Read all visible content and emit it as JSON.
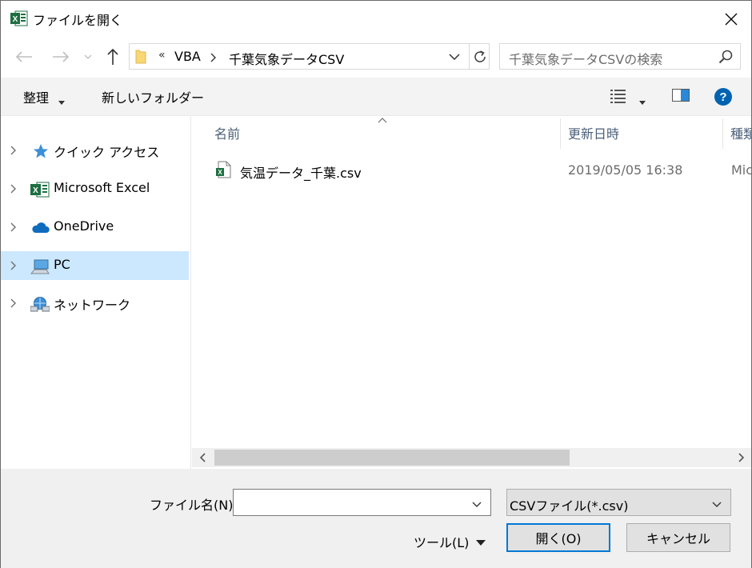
{
  "window": {
    "title": "ファイルを開く"
  },
  "address": {
    "overflow": "«",
    "crumbs": [
      "VBA",
      "千葉気象データCSV"
    ]
  },
  "search": {
    "placeholder": "千葉気象データCSVの検索"
  },
  "toolbar": {
    "organize": "整理",
    "new_folder": "新しいフォルダー"
  },
  "nav": {
    "items": [
      {
        "label": "クイック アクセス",
        "icon": "star-icon"
      },
      {
        "label": "Microsoft Excel",
        "icon": "excel-icon"
      },
      {
        "label": "OneDrive",
        "icon": "cloud-icon"
      },
      {
        "label": "PC",
        "icon": "computer-icon",
        "selected": true
      },
      {
        "label": "ネットワーク",
        "icon": "network-icon"
      }
    ]
  },
  "columns": {
    "name": "名前",
    "date": "更新日時",
    "type": "種類"
  },
  "files": [
    {
      "name": "気温データ_千葉.csv",
      "date": "2019/05/05 16:38",
      "type": "Mic",
      "icon": "excel-csv-icon"
    }
  ],
  "bottom": {
    "filename_label": "ファイル名(N):",
    "filename_value": "",
    "filter": "CSVファイル(*.csv)",
    "tools": "ツール(L)",
    "open": "開く(O)",
    "cancel": "キャンセル"
  },
  "colors": {
    "accent": "#0078d7",
    "selection": "#cce8ff",
    "excel_green": "#1d6f42"
  }
}
